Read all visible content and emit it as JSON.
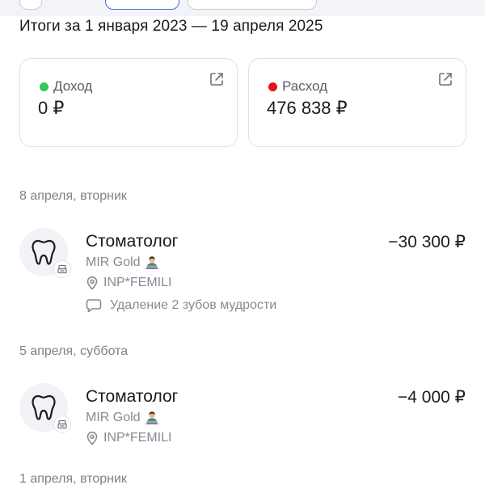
{
  "summary": {
    "title": "Итоги за 1 января 2023 — 19 апреля 2025",
    "income": {
      "label": "Доход",
      "amount": "0 ₽",
      "dot_color": "#34c759"
    },
    "expense": {
      "label": "Расход",
      "amount": "476 838 ₽",
      "dot_color": "#e8101a"
    }
  },
  "groups": [
    {
      "date": "8 апреля, вторник",
      "transactions": [
        {
          "title": "Стоматолог",
          "amount": "−30 300 ₽",
          "card": "MIR Gold",
          "merchant": "INP*FEMILI",
          "comment": "Удаление 2 зубов мудрости",
          "icon": "tooth-icon"
        }
      ]
    },
    {
      "date": "5 апреля, суббота",
      "transactions": [
        {
          "title": "Стоматолог",
          "amount": "−4 000 ₽",
          "card": "MIR Gold",
          "merchant": "INP*FEMILI",
          "icon": "tooth-icon"
        }
      ]
    },
    {
      "date": "1 апреля, вторник"
    }
  ]
}
